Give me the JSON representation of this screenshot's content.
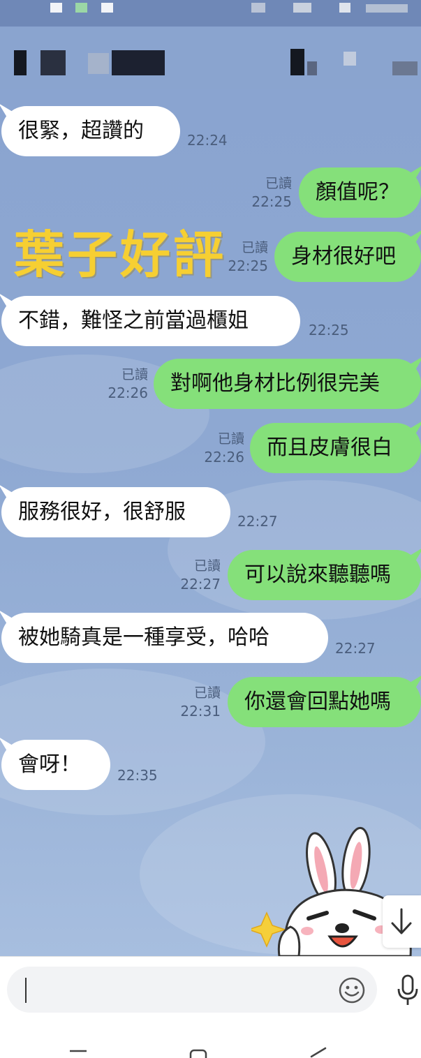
{
  "header": {
    "contact_name": "",
    "obscured": true
  },
  "watermark": {
    "text": "葉子好評",
    "color": "#f6cf32"
  },
  "messages": [
    {
      "side": "in",
      "text": "很緊，超讚的",
      "time": "22:24",
      "read": ""
    },
    {
      "side": "out",
      "text": "顏值呢？",
      "time": "22:25",
      "read": "已讀"
    },
    {
      "side": "out",
      "text": "身材很好吧",
      "time": "22:25",
      "read": "已讀"
    },
    {
      "side": "in",
      "text": "不錯，難怪之前當過櫃姐",
      "time": "22:25",
      "read": ""
    },
    {
      "side": "out",
      "text": "對啊他身材比例很完美",
      "time": "22:26",
      "read": "已讀"
    },
    {
      "side": "out",
      "text": "而且皮膚很白",
      "time": "22:26",
      "read": "已讀"
    },
    {
      "side": "in",
      "text": "服務很好，很舒服",
      "time": "22:27",
      "read": ""
    },
    {
      "side": "out",
      "text": "可以說來聽聽嗎",
      "time": "22:27",
      "read": "已讀"
    },
    {
      "side": "in",
      "text": "被她騎真是一種享受，哈哈",
      "time": "22:27",
      "read": ""
    },
    {
      "side": "out",
      "text": "你還會回點她嗎",
      "time": "22:31",
      "read": "已讀"
    },
    {
      "side": "in",
      "text": "會呀！",
      "time": "22:35",
      "read": ""
    }
  ],
  "sticker": {
    "icon": "bunny-sticker-icon"
  },
  "composer": {
    "input_value": "",
    "input_placeholder": "",
    "emoji_icon": "smiley-icon",
    "mic_icon": "microphone-icon"
  },
  "nav": {
    "items": [
      "recents-icon",
      "home-icon",
      "back-icon"
    ]
  },
  "colors": {
    "chat_background": "#8ea8d2",
    "outgoing_bubble": "#85e07a",
    "incoming_bubble": "#ffffff",
    "watermark": "#f6cf32"
  }
}
